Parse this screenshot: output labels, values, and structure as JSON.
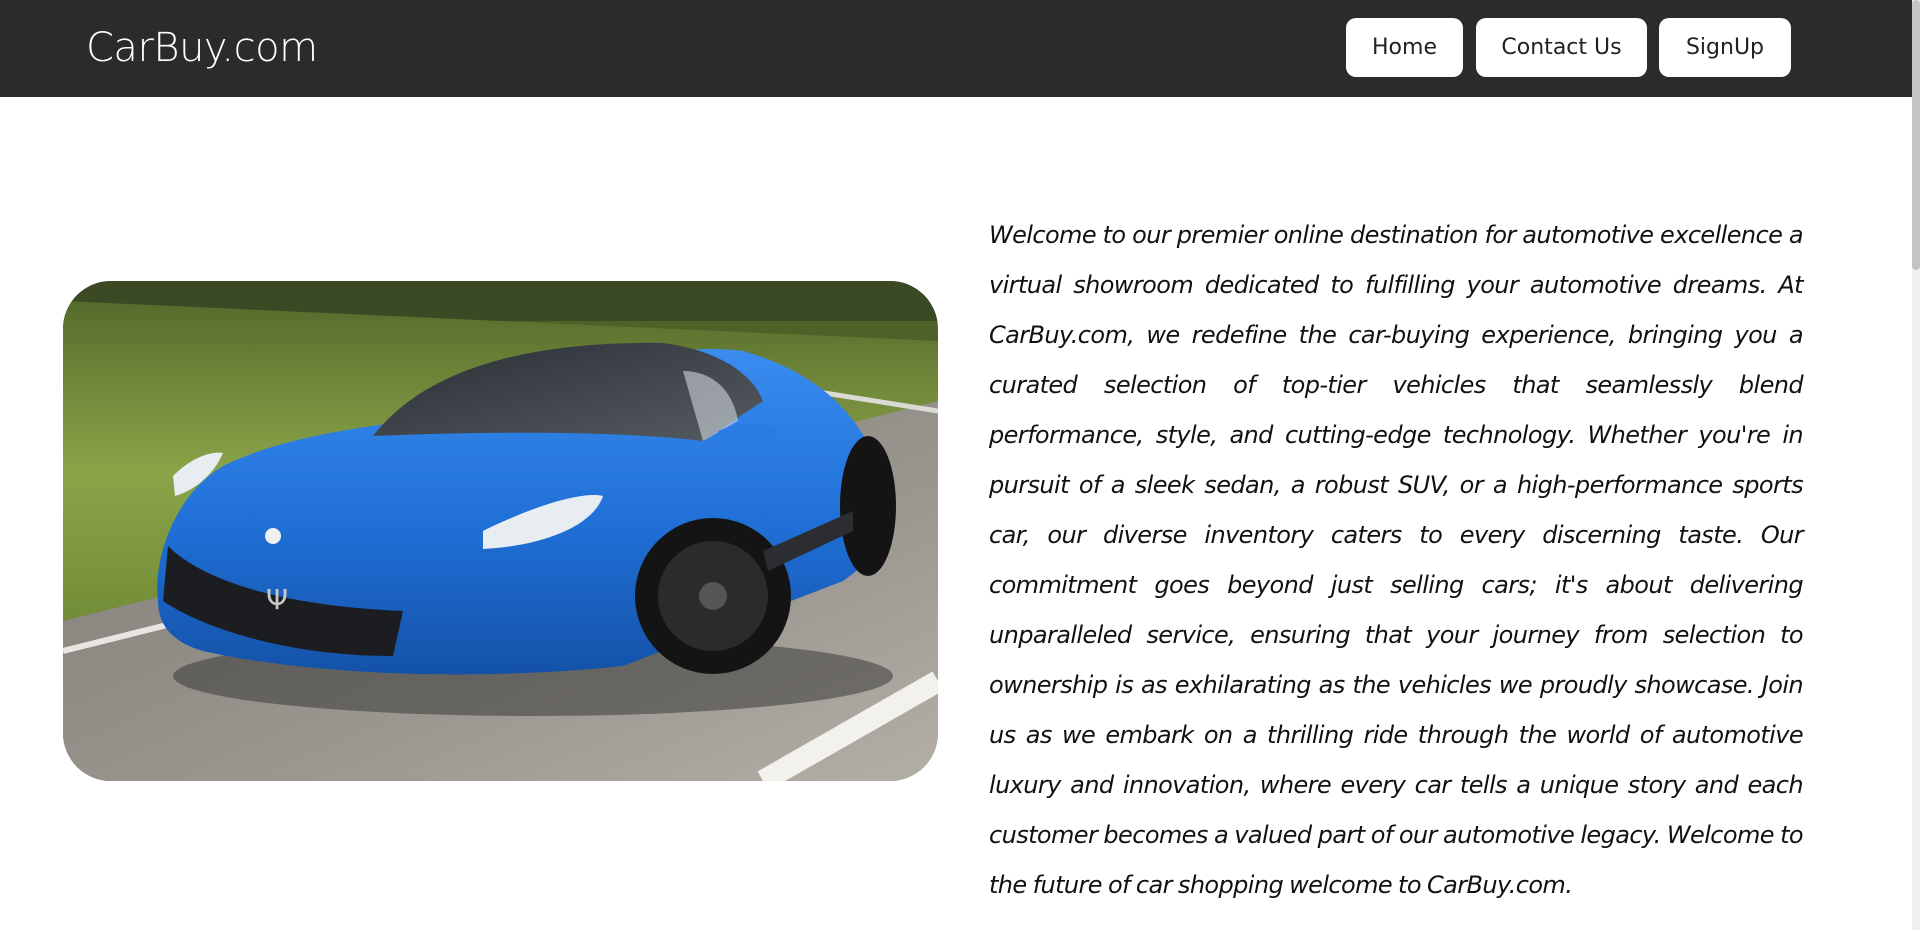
{
  "header": {
    "brand": "CarBuy.com",
    "nav": [
      {
        "label": "Home"
      },
      {
        "label": "Contact Us"
      },
      {
        "label": "SignUp"
      }
    ]
  },
  "hero": {
    "image_description_icon": "car-image",
    "colors": {
      "navbar": "#2b2b2d",
      "car_body": "#1f6fd6",
      "grass": "#7b9a3a",
      "road": "#8d8a85"
    },
    "text": "Welcome to our premier online destination for automotive excellence a virtual showroom dedicated to fulfilling your automotive dreams. At CarBuy.com, we redefine the car-buying experience, bringing you a curated selection of top-tier vehicles that seamlessly blend performance, style, and cutting-edge technology. Whether you're in pursuit of a sleek sedan, a robust SUV, or a high-performance sports car, our diverse inventory caters to every discerning taste. Our commitment goes beyond just selling cars; it's about delivering unparalleled service, ensuring that your journey from selection to ownership is as exhilarating as the vehicles we proudly showcase. Join us as we embark on a thrilling ride through the world of automotive luxury and innovation, where every car tells a unique story and each customer becomes a valued part of our automotive legacy. Welcome to the future of car shopping welcome to CarBuy.com."
  }
}
